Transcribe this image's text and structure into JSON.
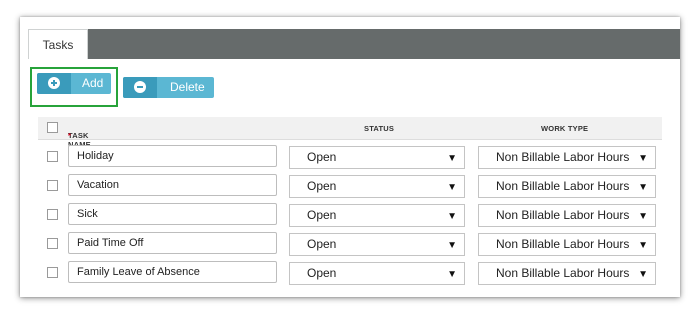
{
  "tabs": [
    {
      "label": "Tasks"
    }
  ],
  "toolbar": {
    "add_label": "Add",
    "delete_label": "Delete",
    "add_icon": "plus-circle-icon",
    "delete_icon": "minus-circle-icon"
  },
  "table": {
    "headers": {
      "task_name": "TASK NAME",
      "required_marker": "*",
      "status": "STATUS",
      "work_type": "WORK TYPE"
    },
    "rows": [
      {
        "task_name": "Holiday",
        "status": "Open",
        "work_type": "Non Billable Labor Hours"
      },
      {
        "task_name": "Vacation",
        "status": "Open",
        "work_type": "Non Billable Labor Hours"
      },
      {
        "task_name": "Sick",
        "status": "Open",
        "work_type": "Non Billable Labor Hours"
      },
      {
        "task_name": "Paid Time Off",
        "status": "Open",
        "work_type": "Non Billable Labor Hours"
      },
      {
        "task_name": "Family Leave of Absence",
        "status": "Open",
        "work_type": "Non Billable Labor Hours"
      }
    ]
  },
  "colors": {
    "tab_bar": "#666b6b",
    "button": "#5bb7d3",
    "button_icon": "#3a9bbb",
    "highlight": "#27a33a",
    "required": "#d0021b"
  }
}
